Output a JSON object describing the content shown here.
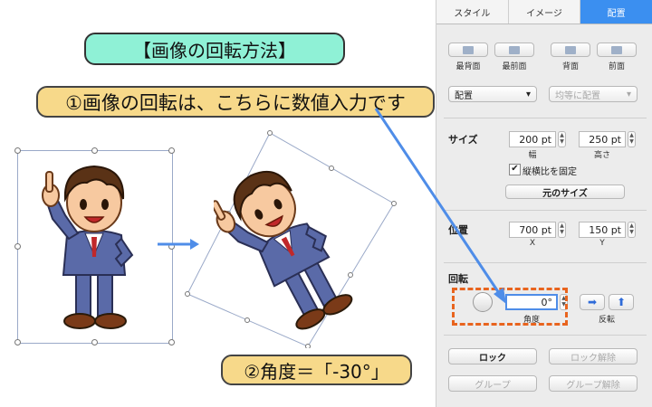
{
  "callouts": {
    "title": "【画像の回転方法】",
    "step1": "①画像の回転は、こちらに数値入力です",
    "step2": "②角度＝「-30°」"
  },
  "panel": {
    "tabs": [
      {
        "label": "スタイル",
        "active": false
      },
      {
        "label": "イメージ",
        "active": false
      },
      {
        "label": "配置",
        "active": true
      }
    ],
    "arrange_buttons": [
      "最背面",
      "最前面",
      "背面",
      "前面"
    ],
    "align_dropdown": "配置",
    "distribute_dropdown": "均等に配置",
    "size": {
      "title": "サイズ",
      "width_value": "200 pt",
      "width_label": "幅",
      "height_value": "250 pt",
      "height_label": "高さ",
      "lock_aspect_label": "縦横比を固定",
      "original_size_button": "元のサイズ"
    },
    "position": {
      "title": "位置",
      "x_value": "700 pt",
      "x_label": "X",
      "y_value": "150 pt",
      "y_label": "Y"
    },
    "rotation": {
      "title": "回転",
      "angle_value": "0°",
      "angle_label": "角度",
      "flip_label": "反転"
    },
    "lock_button": "ロック",
    "unlock_button": "ロック解除",
    "group_button": "グループ",
    "ungroup_button": "グループ解除"
  },
  "colors": {
    "accent": "#3b8ff0",
    "title_pill": "#8ff1d6",
    "step_pill": "#f7d98a",
    "highlight_box": "#e8641e",
    "arrow": "#4f8de8"
  },
  "icons": [
    "businessman-illustration",
    "right-arrow-icon",
    "flip-horizontal-icon",
    "flip-vertical-icon",
    "dial-icon"
  ]
}
